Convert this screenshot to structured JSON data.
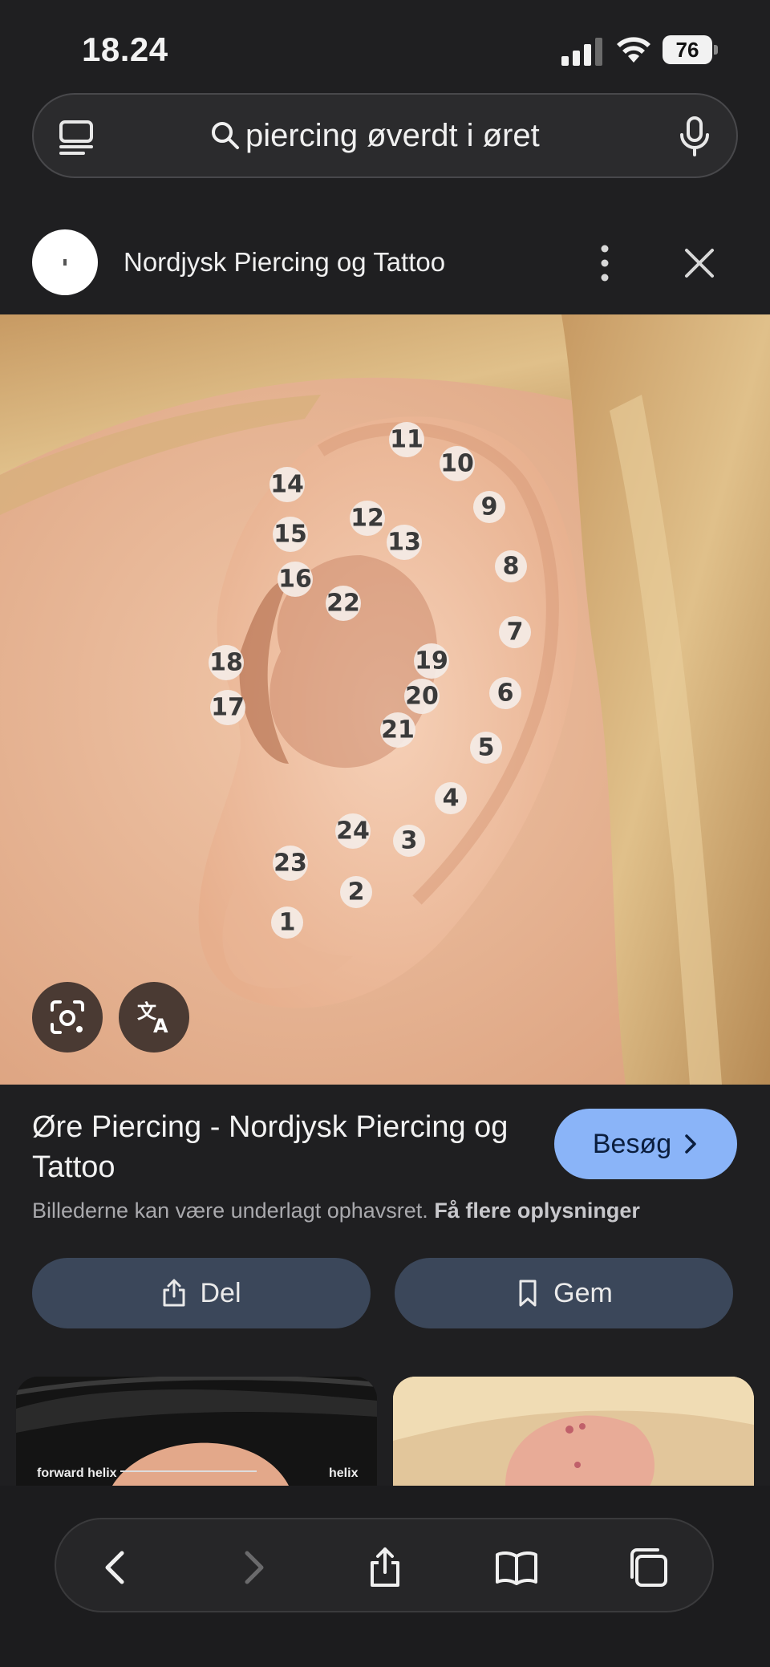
{
  "status_bar": {
    "time": "18.24",
    "battery": "76"
  },
  "search": {
    "query": "piercing øverdt i øret"
  },
  "source": {
    "name": "Nordjysk Piercing og Tattoo"
  },
  "image": {
    "markers": [
      "1",
      "2",
      "3",
      "4",
      "5",
      "6",
      "7",
      "8",
      "9",
      "10",
      "11",
      "12",
      "13",
      "14",
      "15",
      "16",
      "17",
      "18",
      "19",
      "20",
      "21",
      "22",
      "23",
      "24"
    ]
  },
  "result": {
    "title": "Øre Piercing - Nordjysk Piercing og Tattoo",
    "visit_label": "Besøg",
    "copyright_text": "Billederne kan være underlagt ophavsret.",
    "copyright_link": "Få flere oplysninger"
  },
  "actions": {
    "share_label": "Del",
    "save_label": "Gem"
  },
  "related": {
    "thumb1_left_label": "forward helix",
    "thumb1_right_label": "helix"
  },
  "colors": {
    "accent": "#8ab4f8",
    "action_bg": "#3b475a",
    "background": "#1f1f21"
  }
}
